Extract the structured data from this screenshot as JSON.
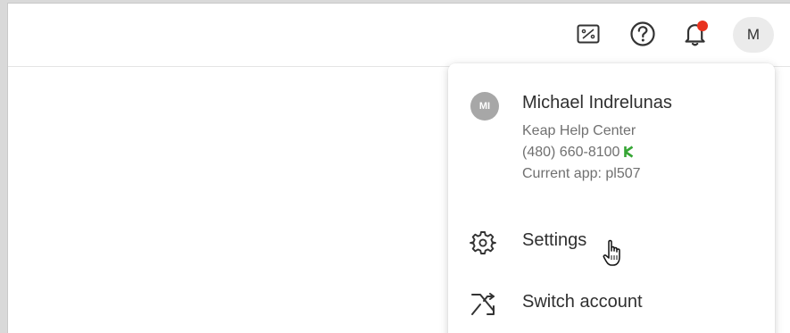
{
  "header": {
    "icons": [
      "reports-icon",
      "help-icon",
      "notifications-icon"
    ],
    "notification_dot_color": "#e8321f",
    "avatar_initial": "M"
  },
  "user_menu": {
    "avatar_initials": "MI",
    "name": "Michael Indrelunas",
    "help_center": "Keap Help Center",
    "phone": "(480) 660-8100",
    "current_app": "Current app: pl507",
    "brand_color": "#36a635",
    "items": [
      {
        "label": "Settings",
        "icon": "gear-icon"
      },
      {
        "label": "Switch account",
        "icon": "shuffle-icon"
      }
    ]
  }
}
